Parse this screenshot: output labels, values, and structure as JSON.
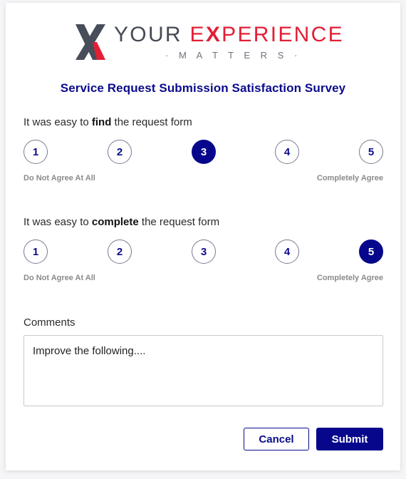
{
  "logo": {
    "title_pre": "YOUR ",
    "title_red": "E",
    "title_x": "X",
    "title_post": "PERIENCE",
    "subtitle": "· M A T T E R S ·"
  },
  "survey": {
    "title": "Service Request Submission Satisfaction Survey",
    "questions": [
      {
        "prefix": "It was easy to ",
        "bold": "find",
        "suffix": " the request form",
        "options": [
          "1",
          "2",
          "3",
          "4",
          "5"
        ],
        "selected": "3",
        "low_label": "Do Not Agree At All",
        "high_label": "Completely Agree"
      },
      {
        "prefix": "It was easy to ",
        "bold": "complete",
        "suffix": " the request form",
        "options": [
          "1",
          "2",
          "3",
          "4",
          "5"
        ],
        "selected": "5",
        "low_label": "Do Not Agree At All",
        "high_label": "Completely Agree"
      }
    ],
    "comments": {
      "label": "Comments",
      "value": "Improve the following...."
    }
  },
  "buttons": {
    "cancel": "Cancel",
    "submit": "Submit"
  },
  "colors": {
    "primary": "#07078c",
    "brand_red": "#e21f35",
    "brand_gray": "#444a55"
  }
}
